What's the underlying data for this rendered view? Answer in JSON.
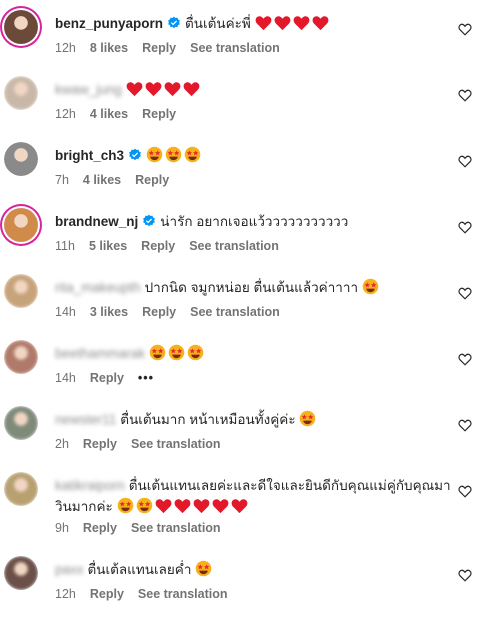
{
  "comments": [
    {
      "username": "benz_punyaporn",
      "blurred": false,
      "verified": true,
      "text": "ตื่นเต้นค่ะพี่",
      "hearts": 4,
      "stars": 0,
      "time": "12h",
      "likes": "8 likes",
      "reply": "Reply",
      "translate": "See translation",
      "dots": "",
      "avatar_color": "#6b4a3a",
      "ring": true
    },
    {
      "username": "kwaw_jung",
      "blurred": true,
      "verified": false,
      "text": "",
      "hearts": 4,
      "stars": 0,
      "time": "12h",
      "likes": "4 likes",
      "reply": "Reply",
      "translate": "",
      "dots": "",
      "avatar_color": "#c9b8a8",
      "ring": false
    },
    {
      "username": "bright_ch3",
      "blurred": false,
      "verified": true,
      "text": "",
      "hearts": 0,
      "stars": 3,
      "time": "7h",
      "likes": "4 likes",
      "reply": "Reply",
      "translate": "",
      "dots": "",
      "avatar_color": "#8a8a8a",
      "ring": false
    },
    {
      "username": "brandnew_nj",
      "blurred": false,
      "verified": true,
      "text": "น่ารัก อยากเจอแว้ววววววววววว",
      "hearts": 0,
      "stars": 0,
      "time": "11h",
      "likes": "5 likes",
      "reply": "Reply",
      "translate": "See translation",
      "dots": "",
      "avatar_color": "#d08a4a",
      "ring": true
    },
    {
      "username": "rita_makeupth",
      "blurred": true,
      "verified": false,
      "text": "ปากนิด จมูกหน่อย ตื่นเต้นแล้วค่าาาา",
      "hearts": 0,
      "stars": 1,
      "time": "14h",
      "likes": "3 likes",
      "reply": "Reply",
      "translate": "See translation",
      "dots": "",
      "avatar_color": "#c7a37a",
      "ring": false
    },
    {
      "username": "beethammarak",
      "blurred": true,
      "verified": false,
      "text": "",
      "hearts": 0,
      "stars": 3,
      "time": "14h",
      "likes": "",
      "reply": "Reply",
      "translate": "",
      "dots": "•••",
      "avatar_color": "#b07a6a",
      "ring": false
    },
    {
      "username": "newster11",
      "blurred": true,
      "verified": false,
      "text": "ตื่นเต้นมาก หน้าเหมือนทั้งคู่ค่ะ",
      "hearts": 0,
      "stars": 1,
      "time": "2h",
      "likes": "",
      "reply": "Reply",
      "translate": "See translation",
      "dots": "",
      "avatar_color": "#7f8a7a",
      "ring": false
    },
    {
      "username": "katikraiporn",
      "blurred": true,
      "verified": false,
      "text": "ตื่นเต้นแทนเลยค่ะและดีใจและยินดีกับคุณแม่คู่กับคุณมาวินมากค่ะ",
      "hearts": 5,
      "stars": 2,
      "time": "9h",
      "likes": "",
      "reply": "Reply",
      "translate": "See translation",
      "dots": "",
      "avatar_color": "#b8a070",
      "ring": false
    },
    {
      "username": "paxx",
      "blurred": true,
      "verified": false,
      "text": "ตื่นเต้ลแทนเลยค่ำ",
      "hearts": 0,
      "stars": 1,
      "time": "12h",
      "likes": "",
      "reply": "Reply",
      "translate": "See translation",
      "dots": "",
      "avatar_color": "#6a5048",
      "ring": false
    }
  ]
}
